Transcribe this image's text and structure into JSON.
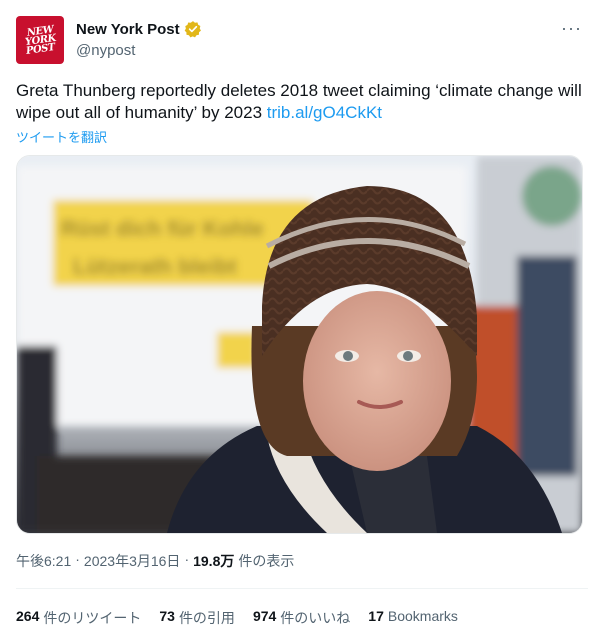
{
  "author": {
    "display_name": "New York Post",
    "handle": "@nypost",
    "avatar_lines": [
      "NEW",
      "YORK",
      "POST"
    ],
    "verified_icon": "verified-badge-gold"
  },
  "more_label": "···",
  "tweet": {
    "text": "Greta Thunberg reportedly deletes 2018 tweet claiming ‘climate change will wipe out all of humanity’ by 2023 ",
    "link": "trib.al/gO4CkKt",
    "translate_label": "ツイートを翻訳"
  },
  "media": {
    "banner_text_line1": "Rüst dich für Kohle",
    "banner_text_line2": "Lützerath bleibt"
  },
  "meta": {
    "time": "午後6:21",
    "separator": "·",
    "date": "2023年3月16日",
    "separator2": "·",
    "views_count": "19.8万",
    "views_label": "件の表示"
  },
  "stats": {
    "retweets_count": "264",
    "retweets_label": "件のリツイート",
    "quotes_count": "73",
    "quotes_label": "件の引用",
    "likes_count": "974",
    "likes_label": "件のいいね",
    "bookmarks_count": "17",
    "bookmarks_label": "Bookmarks"
  },
  "colors": {
    "accent": "#1d9bf0",
    "avatar_red": "#c8102e",
    "verified_gold": "#e2b719"
  }
}
